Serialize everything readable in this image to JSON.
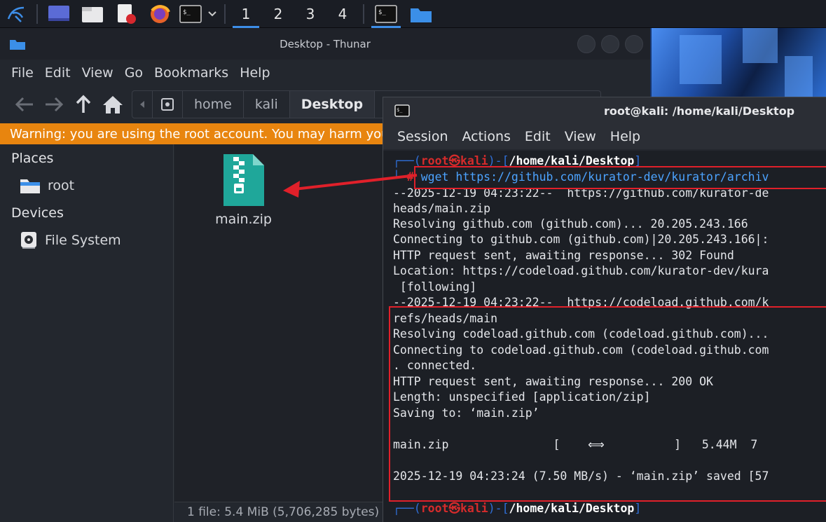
{
  "panel": {
    "workspaces": [
      "1",
      "2",
      "3",
      "4"
    ],
    "active_workspace": "1"
  },
  "thunar": {
    "title": "Desktop - Thunar",
    "menu": [
      "File",
      "Edit",
      "View",
      "Go",
      "Bookmarks",
      "Help"
    ],
    "path_segments": [
      "home",
      "kali",
      "Desktop"
    ],
    "warning": "Warning: you are using the root account. You may harm your system.",
    "places_header": "Places",
    "places": [
      {
        "label": "root",
        "icon": "folder-home-icon"
      }
    ],
    "devices_header": "Devices",
    "devices": [
      {
        "label": "File System",
        "icon": "drive-icon"
      }
    ],
    "file": {
      "name": "main.zip",
      "icon": "zip-archive-icon"
    },
    "status": "1 file: 5.4 MiB (5,706,285 bytes)"
  },
  "terminal": {
    "title": "root@kali: /home/kali/Desktop",
    "menu": [
      "Session",
      "Actions",
      "Edit",
      "View",
      "Help"
    ],
    "prompt": {
      "user": "root㉿kali",
      "path": "/home/kali/Desktop"
    },
    "command": "wget https://github.com/kurator-dev/kurator/archiv",
    "lines": [
      "--2025-12-19 04:23:22--  https://github.com/kurator-de",
      "heads/main.zip",
      "Resolving github.com (github.com)... 20.205.243.166",
      "Connecting to github.com (github.com)|20.205.243.166|:",
      "HTTP request sent, awaiting response... 302 Found",
      "Location: https://codeload.github.com/kurator-dev/kura",
      " [following]",
      "--2025-12-19 04:23:22--  https://codeload.github.com/k",
      "refs/heads/main",
      "Resolving codeload.github.com (codeload.github.com)...",
      "Connecting to codeload.github.com (codeload.github.com",
      ". connected.",
      "HTTP request sent, awaiting response... 200 OK",
      "Length: unspecified [application/zip]",
      "Saving to: ‘main.zip’",
      "",
      "main.zip               [    ⟺          ]   5.44M  7",
      "",
      "2025-12-19 04:23:24 (7.50 MB/s) - ‘main.zip’ saved [57"
    ]
  },
  "colors": {
    "warning": "#e8850f",
    "annotation": "#e0202a",
    "accent": "#3d8ee8"
  }
}
